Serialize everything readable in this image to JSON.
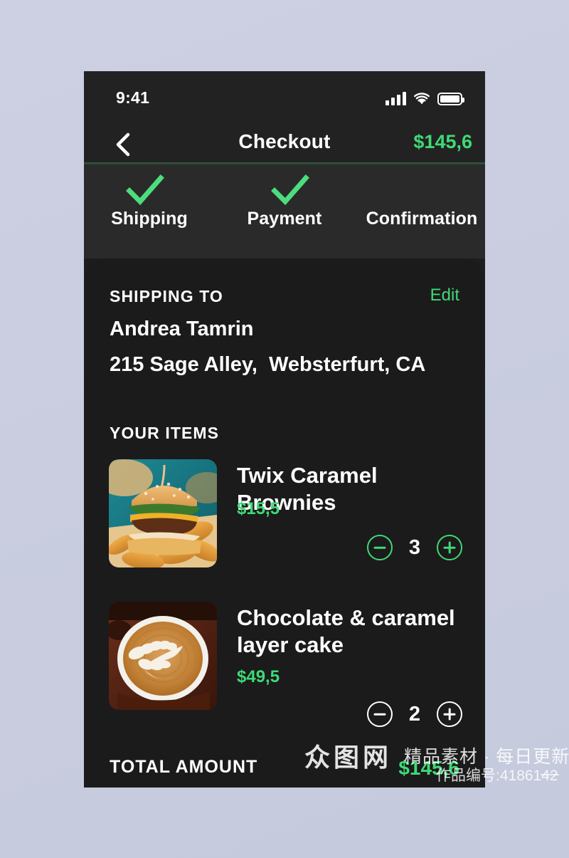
{
  "status_bar": {
    "time": "9:41",
    "signal_icon": "cellular-signal-icon",
    "wifi_icon": "wifi-icon",
    "battery_icon": "battery-icon"
  },
  "nav": {
    "back_icon": "chevron-left-icon",
    "title": "Checkout",
    "total": "$145,6"
  },
  "steps": [
    {
      "label": "Shipping",
      "completed": true,
      "icon": "check-icon"
    },
    {
      "label": "Payment",
      "completed": true,
      "icon": "check-icon"
    },
    {
      "label": "Confirmation",
      "completed": false,
      "icon": ""
    }
  ],
  "shipping": {
    "heading": "SHIPPING TO",
    "edit_label": "Edit",
    "name": "Andrea Tamrin",
    "address": "215 Sage Alley,  Websterfurt, CA"
  },
  "items_section": {
    "heading": "YOUR ITEMS",
    "items": [
      {
        "name": "Twix Caramel Brownies",
        "price": "$15,5",
        "quantity": "3",
        "image": "burger-and-fries-photo",
        "stepper_color": "#3fd977",
        "minus_icon": "minus-circle-icon",
        "plus_icon": "plus-circle-icon"
      },
      {
        "name": "Chocolate & caramel layer cake",
        "price": "$49,5",
        "quantity": "2",
        "image": "latte-art-coffee-photo",
        "stepper_color": "#ffffff",
        "minus_icon": "minus-circle-icon",
        "plus_icon": "plus-circle-icon"
      }
    ]
  },
  "total": {
    "label": "TOTAL AMOUNT",
    "value": "$145,6"
  },
  "watermark": {
    "logo_chars": [
      "众",
      "图",
      "网"
    ],
    "tagline": "精品素材 · 每日更新",
    "id_text": "作品编号:4186142"
  },
  "colors": {
    "accent_green": "#3fd977",
    "page_background": "#ccd0e2",
    "phone_background": "#1d1d1d",
    "card_background": "#1b1b1b",
    "steps_background": "#2a2a2a",
    "bar_background": "#222222"
  }
}
